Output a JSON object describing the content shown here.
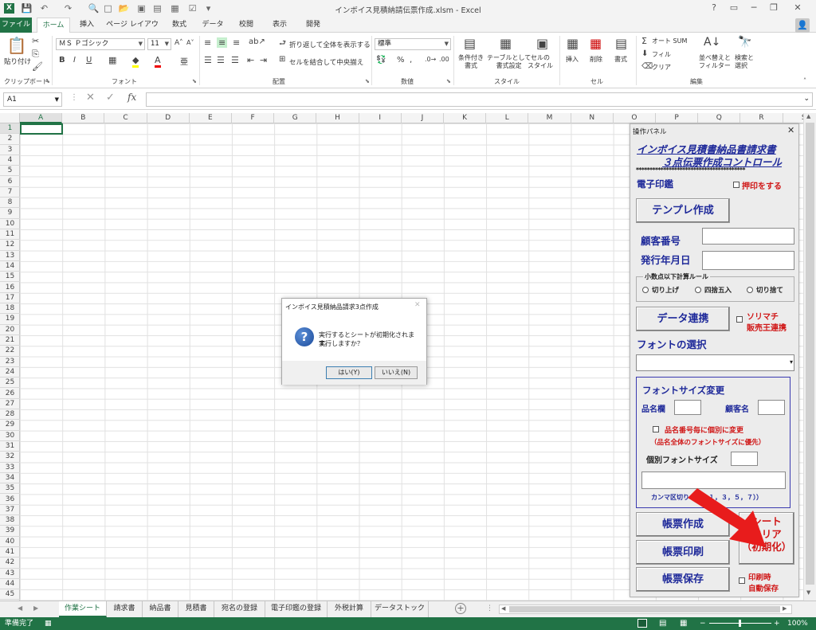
{
  "window": {
    "title": "インボイス見積納請伝票作成.xlsm - Excel"
  },
  "ribbon_tabs": [
    "ファイル",
    "ホーム",
    "挿入",
    "ページ レイアウト",
    "数式",
    "データ",
    "校閲",
    "表示",
    "開発"
  ],
  "ribbon": {
    "clipboard": {
      "paste": "貼り付け",
      "label": "クリップボード"
    },
    "font": {
      "name": "ＭＳ Ｐゴシック",
      "size": "11",
      "label": "フォント"
    },
    "align": {
      "wrap": "折り返して全体を表示する",
      "merge": "セルを結合して中央揃え",
      "label": "配置"
    },
    "number": {
      "format": "標準",
      "label": "数値"
    },
    "styles": {
      "cond": "条件付き\n書式",
      "table": "テーブルとして\n書式設定",
      "cell": "セルの\nスタイル",
      "label": "スタイル"
    },
    "cells": {
      "insert": "挿入",
      "delete": "削除",
      "format": "書式",
      "label": "セル"
    },
    "edit": {
      "autosum": "オート SUM",
      "fill": "フィル",
      "clear": "クリア",
      "sort": "並べ替えと\nフィルター",
      "find": "検索と\n選択",
      "label": "編集"
    }
  },
  "formula_bar": {
    "cell_ref": "A1",
    "content": ""
  },
  "columns": [
    "A",
    "B",
    "C",
    "D",
    "E",
    "F",
    "G",
    "H",
    "I",
    "J",
    "K",
    "L",
    "M",
    "N",
    "O",
    "P",
    "Q",
    "R",
    "S"
  ],
  "rows": [
    "1",
    "2",
    "3",
    "4",
    "5",
    "6",
    "7",
    "8",
    "9",
    "10",
    "11",
    "12",
    "13",
    "14",
    "15",
    "16",
    "17",
    "18",
    "19",
    "20",
    "21",
    "22",
    "23",
    "24",
    "25",
    "26",
    "27",
    "28",
    "29",
    "30",
    "31",
    "32",
    "33",
    "34",
    "35",
    "36",
    "37",
    "38",
    "39",
    "40",
    "41",
    "42",
    "43",
    "44",
    "45"
  ],
  "sheet_tabs": [
    "作業シート",
    "請求書",
    "納品書",
    "見積書",
    "宛名の登録",
    "電子印鑑の登録",
    "外税計算",
    "データストック"
  ],
  "status": {
    "ready": "準備完了",
    "zoom": "100%"
  },
  "dialog": {
    "title": "インボイス見積納品請求3点作成",
    "message_line1": "実行するとシートが初期化されます。",
    "message_line2": "実行しますか？",
    "yes": "はい(Y)",
    "no": "いいえ(N)"
  },
  "panel": {
    "title": "操作パネル",
    "heading1": "インボイス見積書納品書請求書",
    "heading2": "３点伝票作成コントロール",
    "stars": "****************************************",
    "stamp_label": "電子印鑑",
    "stamp_check": "押印をする",
    "template_btn": "テンプレ作成",
    "customer_no": "顧客番号",
    "issue_date": "発行年月日",
    "rounding_group": "小数点以下計算ルール",
    "round_up": "切り上げ",
    "round_half": "四捨五入",
    "round_down": "切り捨て",
    "data_link_btn": "データ連携",
    "sorimachi1": "ソリマチ",
    "sorimachi2": "販売王連携",
    "font_select": "フォントの選択",
    "font_size_group": "フォントサイズ変更",
    "item_col": "品名欄",
    "customer_name": "顧客名",
    "individual_check": "品名番号毎に個別に変更",
    "priority_note": "（品名全体のフォントサイズに優先）",
    "individual_size": "個別フォントサイズ",
    "comma_note": "カンマ区切り（例　１，３，５，７））",
    "create_btn": "帳票作成",
    "print_btn": "帳票印刷",
    "save_btn": "帳票保存",
    "clear1": "シート",
    "clear2": "クリア",
    "clear3": "（初期化）",
    "autosave1": "印刷時",
    "autosave2": "自動保存"
  },
  "colors": {
    "excel_green": "#217346",
    "panel_blue": "#1f2a9a",
    "alert_red": "#d01818"
  }
}
